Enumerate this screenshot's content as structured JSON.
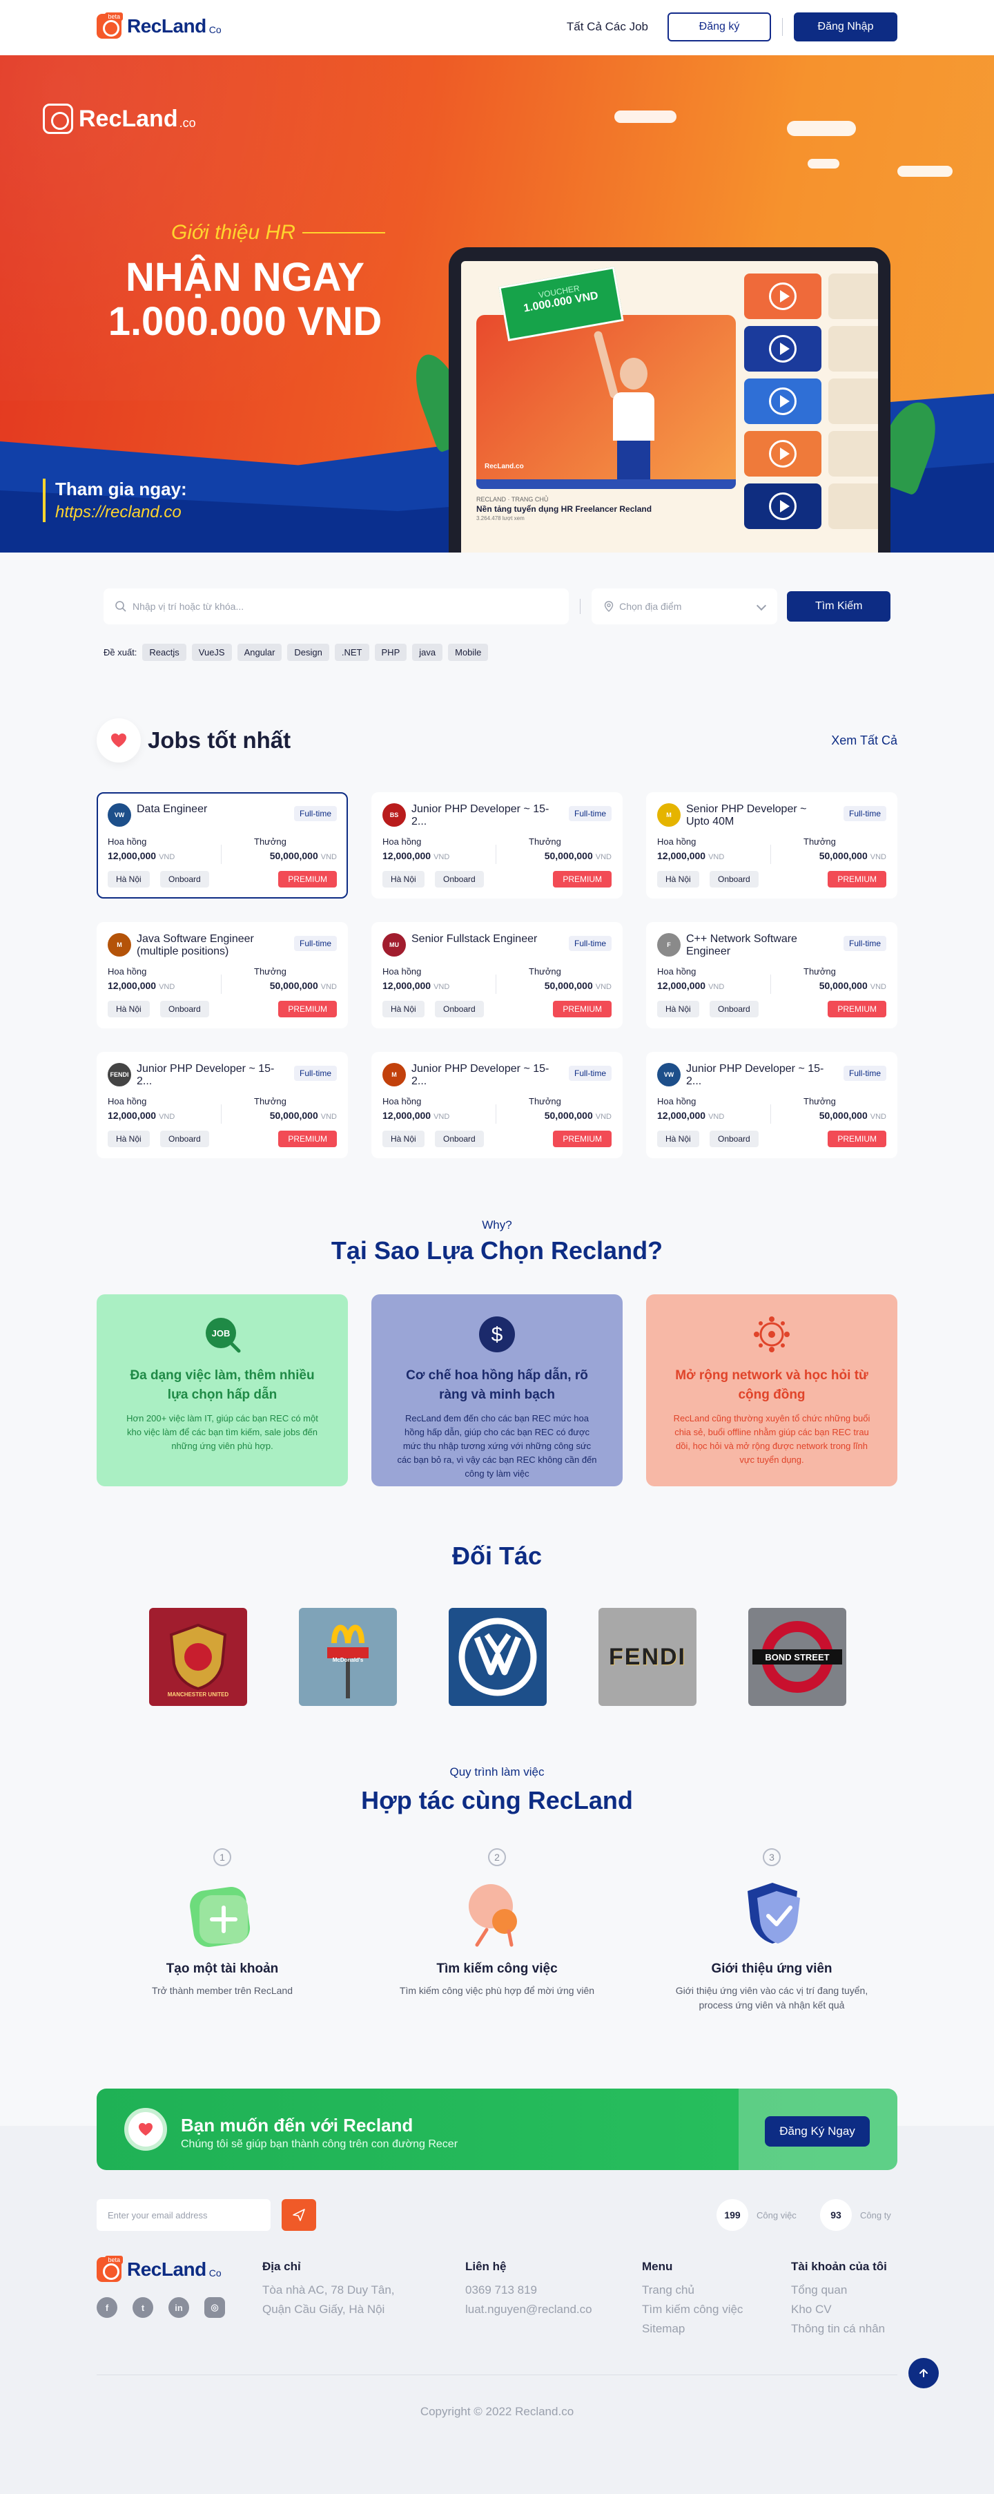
{
  "header": {
    "logo_text": "RecLand",
    "logo_suffix": "Co",
    "logo_badge": "beta",
    "nav_jobs": "Tất Cả Các Job",
    "register": "Đăng ký",
    "login": "Đăng Nhập"
  },
  "hero": {
    "logo_text": "RecLand",
    "logo_suffix": ".co",
    "intro": "Giới thiệu HR",
    "headline_1": "NHẬN NGAY",
    "headline_2": "1.000.000 VND",
    "join_label": "Tham gia ngay:",
    "join_url": "https://recland.co",
    "voucher_label": "VOUCHER",
    "voucher_value": "1.000.000 VND",
    "video_brand": "RecLand.co",
    "video_caption_small": "RECLAND · TRANG CHỦ",
    "video_caption": "Nền tảng tuyển dụng HR Freelancer Recland",
    "video_caption_meta": "3.264.478 lượt xem"
  },
  "search": {
    "placeholder": "Nhập vị trí hoặc từ khóa...",
    "location_placeholder": "Chọn địa điểm",
    "button": "Tìm Kiếm",
    "suggest_label": "Đề xuất:",
    "suggestions": [
      "Reactjs",
      "VueJS",
      "Angular",
      "Design",
      ".NET",
      "PHP",
      "java",
      "Mobile"
    ]
  },
  "jobs": {
    "title": "Jobs tốt nhất",
    "see_all": "Xem Tất Cả",
    "commission_label": "Hoa hồng",
    "bonus_label": "Thưởng",
    "currency": "VND",
    "items": [
      {
        "title": "Data Engineer",
        "type": "Full-time",
        "commission": "12,000,000",
        "bonus": "50,000,000",
        "location": "Hà Nội",
        "mode": "Onboard",
        "badge": "PREMIUM",
        "logo": "VW",
        "logo_color": "#1d4f8a"
      },
      {
        "title": "Junior PHP Developer ~ 15-2...",
        "type": "Full-time",
        "commission": "12,000,000",
        "bonus": "50,000,000",
        "location": "Hà Nội",
        "mode": "Onboard",
        "badge": "PREMIUM",
        "logo": "BS",
        "logo_color": "#b91c1c"
      },
      {
        "title": "Senior PHP Developer ~ Upto 40M",
        "type": "Full-time",
        "commission": "12,000,000",
        "bonus": "50,000,000",
        "location": "Hà Nội",
        "mode": "Onboard",
        "badge": "PREMIUM",
        "logo": "M",
        "logo_color": "#e5b400"
      },
      {
        "title": "Java Software Engineer (multiple positions)",
        "type": "Full-time",
        "commission": "12,000,000",
        "bonus": "50,000,000",
        "location": "Hà Nội",
        "mode": "Onboard",
        "badge": "PREMIUM",
        "logo": "M",
        "logo_color": "#b45309"
      },
      {
        "title": "Senior Fullstack Engineer",
        "type": "Full-time",
        "commission": "12,000,000",
        "bonus": "50,000,000",
        "location": "Hà Nội",
        "mode": "Onboard",
        "badge": "PREMIUM",
        "logo": "MU",
        "logo_color": "#a11d2e"
      },
      {
        "title": "C++ Network Software Engineer",
        "type": "Full-time",
        "commission": "12,000,000",
        "bonus": "50,000,000",
        "location": "Hà Nội",
        "mode": "Onboard",
        "badge": "PREMIUM",
        "logo": "F",
        "logo_color": "#8a8a8a"
      },
      {
        "title": "Junior PHP Developer ~ 15-2...",
        "type": "Full-time",
        "commission": "12,000,000",
        "bonus": "50,000,000",
        "location": "Hà Nội",
        "mode": "Onboard",
        "badge": "PREMIUM",
        "logo": "FENDI",
        "logo_color": "#444444"
      },
      {
        "title": "Junior PHP Developer ~ 15-2...",
        "type": "Full-time",
        "commission": "12,000,000",
        "bonus": "50,000,000",
        "location": "Hà Nội",
        "mode": "Onboard",
        "badge": "PREMIUM",
        "logo": "M",
        "logo_color": "#c2410c"
      },
      {
        "title": "Junior PHP Developer ~ 15-2...",
        "type": "Full-time",
        "commission": "12,000,000",
        "bonus": "50,000,000",
        "location": "Hà Nội",
        "mode": "Onboard",
        "badge": "PREMIUM",
        "logo": "VW",
        "logo_color": "#1d4f8a"
      }
    ]
  },
  "why": {
    "subtitle": "Why?",
    "title": "Tại Sao Lựa Chọn Recland?",
    "cards": [
      {
        "title": "Đa dạng việc làm, thêm nhiều lựa chọn hấp dẫn",
        "text": "Hơn 200+ việc làm IT, giúp các bạn REC có một kho việc làm để các bạn tìm kiếm, sale jobs đến những ứng viên phù hợp.",
        "bg": "#aaefc3",
        "color": "#1f8a46",
        "icon": "job-icon"
      },
      {
        "title": "Cơ chế hoa hồng hấp dẫn, rõ ràng và minh bạch",
        "text": "RecLand đem đến cho các bạn REC mức hoa hồng hấp dẫn, giúp cho các bạn REC có được mức thu nhập tương xứng với những công sức các bạn bỏ ra, vì vậy các bạn REC không cần đến công ty làm việc",
        "bg": "#9aa5d6",
        "color": "#1b2a6b",
        "icon": "dollar-icon"
      },
      {
        "title": "Mở rộng network và học hỏi từ cộng đồng",
        "text": "RecLand cũng thường xuyên tổ chức những buổi chia sẻ, buổi offline nhằm giúp các bạn REC trau dồi, học hỏi và mở rộng được network trong lĩnh vực tuyển dụng.",
        "bg": "#f7b8a6",
        "color": "#e0442a",
        "icon": "network-icon"
      }
    ]
  },
  "partners": {
    "title": "Đối Tác",
    "items": [
      {
        "name": "Manchester United",
        "label": "MANCHESTER UNITED",
        "bg": "#a11d2e"
      },
      {
        "name": "McDonald's",
        "label": "McDonald's",
        "bg": "#7fa3b8"
      },
      {
        "name": "Volkswagen",
        "label": "VW",
        "bg": "#1d4f8a"
      },
      {
        "name": "Fendi",
        "label": "FENDI",
        "bg": "#a8a8a8"
      },
      {
        "name": "Bond Street",
        "label": "BOND STREET",
        "bg": "#7e8187"
      }
    ]
  },
  "process": {
    "subtitle": "Quy trình làm việc",
    "title": "Hợp tác cùng RecLand",
    "steps": [
      {
        "num": "1",
        "title": "Tạo một tài khoản",
        "text": "Trở thành member trên RecLand"
      },
      {
        "num": "2",
        "title": "Tìm kiếm công việc",
        "text": "Tìm kiếm công việc phù hợp để mời ứng viên"
      },
      {
        "num": "3",
        "title": "Giới thiệu ứng viên",
        "text": "Giới thiệu ứng viên vào các vị trí đang tuyển, process ứng viên và nhận kết quả"
      }
    ]
  },
  "cta": {
    "title": "Bạn muốn đến với Recland",
    "text": "Chúng tôi sẽ giúp bạn thành công trên con đường Recer",
    "button": "Đăng Ký Ngay"
  },
  "footer": {
    "email_placeholder": "Enter your email address",
    "stats": [
      {
        "value": "199",
        "label": "Công việc"
      },
      {
        "value": "93",
        "label": "Công ty"
      }
    ],
    "logo_text": "RecLand",
    "logo_suffix": "Co",
    "logo_badge": "beta",
    "address_title": "Địa chỉ",
    "address_1": "Tòa nhà AC, 78 Duy Tân,",
    "address_2": "Quận Cầu Giấy, Hà Nội",
    "contact_title": "Liên hệ",
    "phone": "0369 713 819",
    "email": "luat.nguyen@recland.co",
    "menu_title": "Menu",
    "menu": [
      "Trang chủ",
      "Tìm kiếm công việc",
      "Sitemap"
    ],
    "account_title": "Tài khoản của tôi",
    "account": [
      "Tổng quan",
      "Kho CV",
      "Thông tin cá nhân"
    ],
    "copyright": "Copyright © 2022 Recland.co"
  }
}
